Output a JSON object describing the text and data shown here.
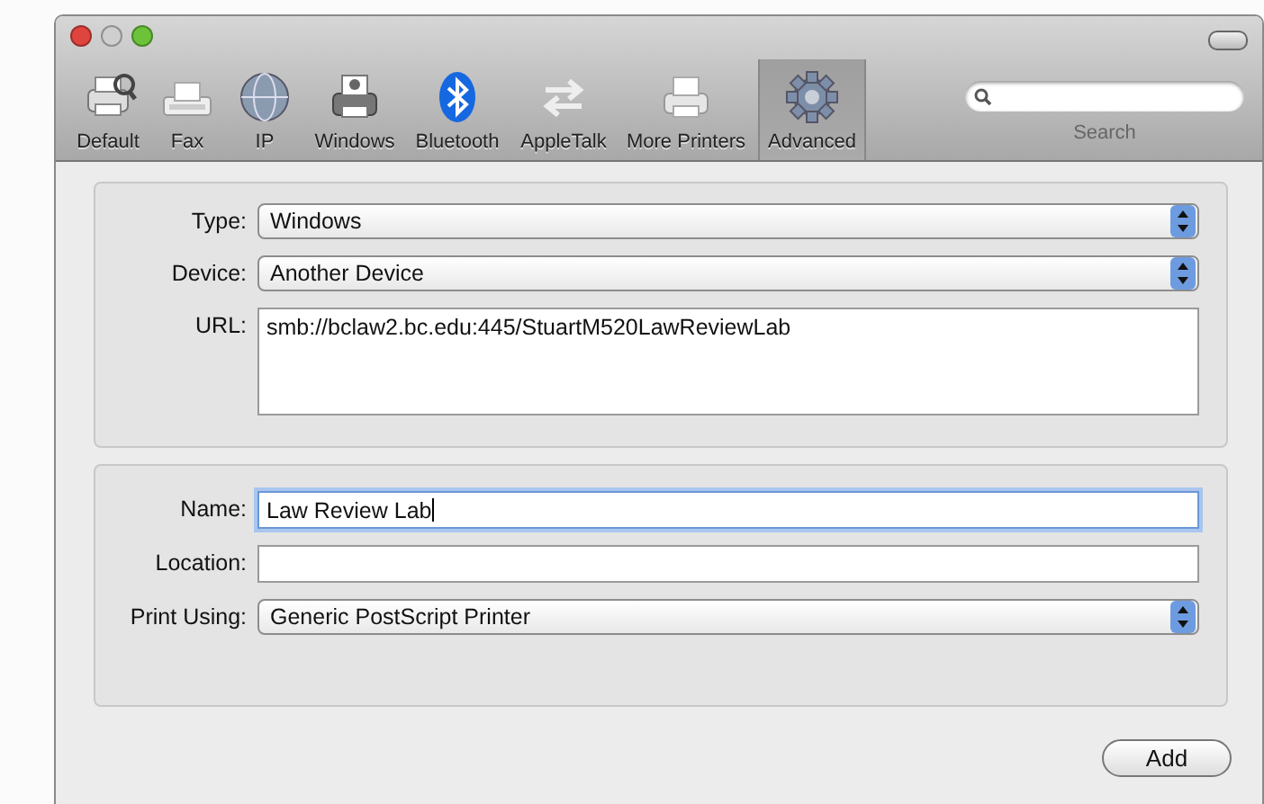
{
  "toolbar": {
    "items": [
      {
        "label": "Default",
        "selected": false
      },
      {
        "label": "Fax",
        "selected": false
      },
      {
        "label": "IP",
        "selected": false
      },
      {
        "label": "Windows",
        "selected": false
      },
      {
        "label": "Bluetooth",
        "selected": false
      },
      {
        "label": "AppleTalk",
        "selected": false
      },
      {
        "label": "More Printers",
        "selected": false
      },
      {
        "label": "Advanced",
        "selected": true
      }
    ],
    "search": {
      "label": "Search"
    }
  },
  "connection_group": {
    "fields": [
      {
        "kind": "popup",
        "label": "Type:",
        "value": "Windows"
      },
      {
        "kind": "popup",
        "label": "Device:",
        "value": "Another Device"
      },
      {
        "kind": "textarea",
        "label": "URL:",
        "value": "smb://bclaw2.bc.edu:445/StuartM520LawReviewLab"
      }
    ]
  },
  "printer_group": {
    "fields": [
      {
        "kind": "text",
        "label": "Name:",
        "value": "Law Review Lab",
        "focused": true
      },
      {
        "kind": "text",
        "label": "Location:",
        "focused": false
      },
      {
        "kind": "popup",
        "label": "Print Using:",
        "value": "Generic PostScript Printer"
      }
    ]
  },
  "buttons": [
    "Add"
  ]
}
